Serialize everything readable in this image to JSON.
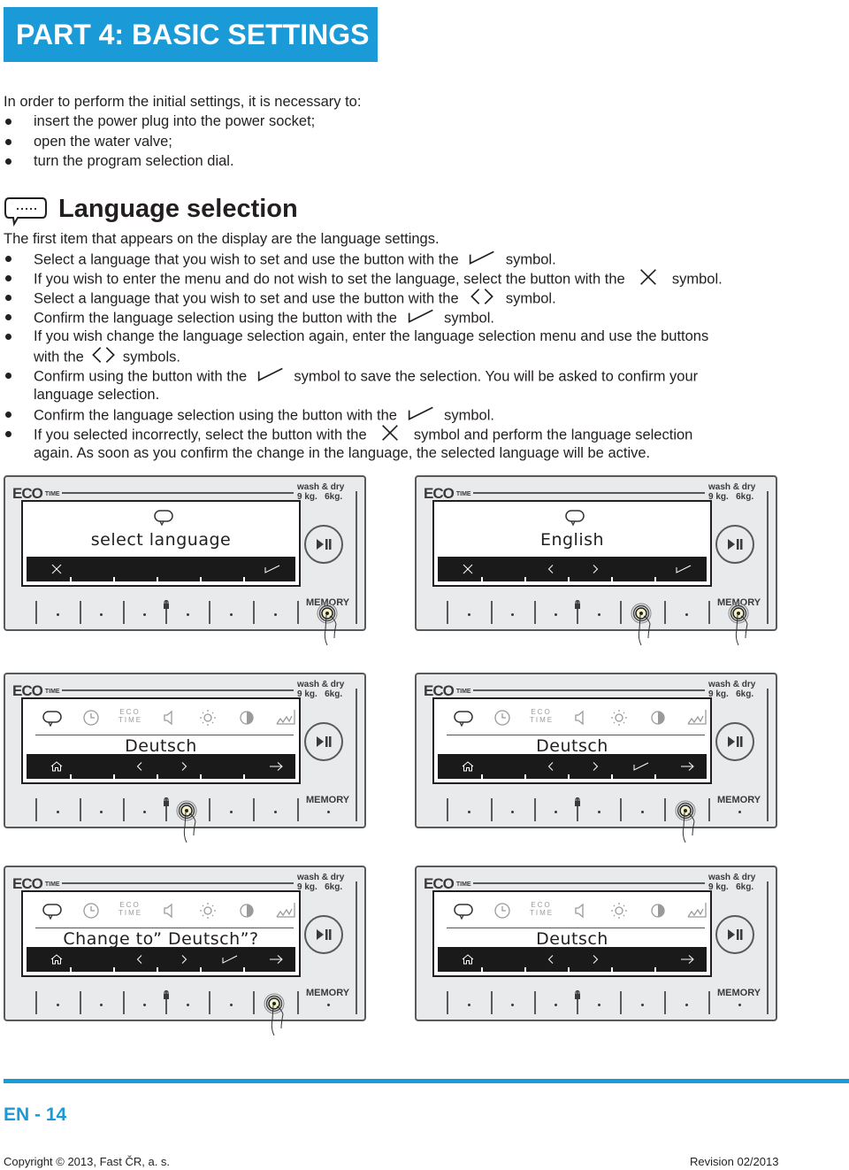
{
  "header": {
    "title": "PART 4: BASIC SETTINGS"
  },
  "intro": {
    "lead": "In order to perform the initial settings, it is necessary to:",
    "items": [
      "insert the power plug into the power socket;",
      "open the water valve;",
      "turn the program selection dial."
    ]
  },
  "language_section": {
    "icon": "speech-bubble-icon",
    "heading": "Language selection",
    "lead": "The first item that appears on the display are the language settings.",
    "steps": [
      {
        "before": "Select a language that you wish to set and use the button with the",
        "symbol": "check-icon",
        "after": "symbol."
      },
      {
        "before": "If you wish to enter the menu and do not wish to set the language, select the button with the",
        "symbol": "cross-icon",
        "after": "symbol."
      },
      {
        "before": "Select a language that you wish to set and use the button with the",
        "symbol": "arrows-icon",
        "after": "symbol."
      },
      {
        "before": "Confirm the language selection using the button with the",
        "symbol": "check-icon",
        "after": "symbol."
      },
      {
        "before": "If you wish change the language selection again, enter the language selection menu and use the buttons",
        "line2_before": "with the",
        "symbol": "arrows-icon",
        "after": "symbols."
      },
      {
        "before": "Confirm using the button with the",
        "symbol": "check-icon",
        "after": "symbol to save the selection. You will be asked to confirm your",
        "line2": "language selection."
      },
      {
        "before": "Confirm the language selection using the button with the",
        "symbol": "check-icon",
        "after": "symbol."
      },
      {
        "before": "If you selected incorrectly, select the button with the",
        "symbol": "cross-icon",
        "after": "symbol and perform the language selection",
        "line2": "again. As soon as you confirm the change in the language, the selected language will be active."
      }
    ]
  },
  "panels": {
    "brand": "ECO",
    "brand_sub": "TIME",
    "model": "wash & dry\n9 kg.   6kg.",
    "memory_label": "MEMORY",
    "menu_eco_label": "ECO\nTIME",
    "items": [
      {
        "screen_text": "select language",
        "mode": "prompt",
        "softkeys": [
          "cross",
          "check"
        ],
        "pressed": [
          6
        ]
      },
      {
        "screen_text": "English",
        "mode": "prompt",
        "softkeys": [
          "cross",
          "prev",
          "next",
          "check"
        ],
        "pressed": [
          4,
          6
        ]
      },
      {
        "screen_text": "Deutsch",
        "mode": "menu",
        "softkeys": [
          "home",
          "prev",
          "next",
          "forward"
        ],
        "pressed": [
          3
        ]
      },
      {
        "screen_text": "Deutsch",
        "mode": "menu",
        "softkeys": [
          "home",
          "prev",
          "next",
          "check",
          "forward"
        ],
        "pressed": [
          5
        ]
      },
      {
        "screen_text": "Change to” Deutsch”?",
        "mode": "menu",
        "softkeys": [
          "home",
          "prev",
          "next",
          "check",
          "forward"
        ],
        "pressed": [
          5
        ]
      },
      {
        "screen_text": "Deutsch",
        "mode": "menu",
        "softkeys": [
          "home",
          "prev",
          "next",
          "forward"
        ],
        "pressed": []
      }
    ]
  },
  "footer": {
    "page": "EN - 14",
    "copyright": "Copyright © 2013, Fast ČR, a. s.",
    "revision": "Revision 02/2013"
  },
  "colors": {
    "accent": "#1a9ad6",
    "panel": "#e9eaeb",
    "text": "#231f20"
  }
}
